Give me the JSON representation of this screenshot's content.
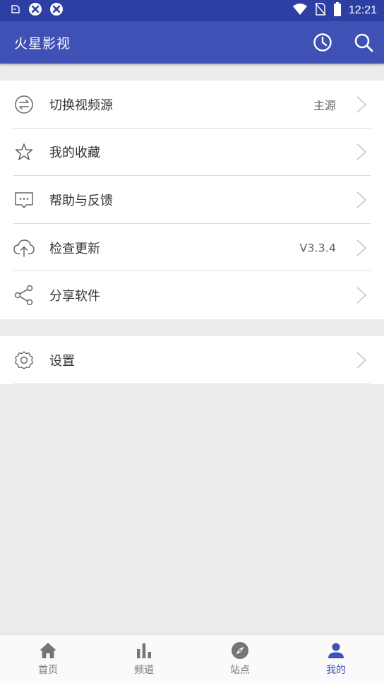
{
  "status_bar": {
    "time": "12:21",
    "icons": [
      "notification-icon",
      "app-notification-icon",
      "app-notification-icon",
      "wifi-icon",
      "no-sim-icon",
      "battery-icon"
    ]
  },
  "app_bar": {
    "title": "火星影视",
    "actions": [
      "history-icon",
      "search-icon"
    ]
  },
  "menu_group_1": [
    {
      "label": "切换视频源",
      "value": "主源",
      "icon": "switch-icon"
    },
    {
      "label": "我的收藏",
      "value": "",
      "icon": "star-icon"
    },
    {
      "label": "帮助与反馈",
      "value": "",
      "icon": "feedback-icon"
    },
    {
      "label": "检查更新",
      "value": "V3.3.4",
      "icon": "cloud-upload-icon"
    },
    {
      "label": "分享软件",
      "value": "",
      "icon": "share-icon"
    }
  ],
  "menu_group_2": [
    {
      "label": "设置",
      "value": "",
      "icon": "settings-icon"
    }
  ],
  "bottom_nav": {
    "items": [
      {
        "label": "首页",
        "icon": "home-icon"
      },
      {
        "label": "频道",
        "icon": "bar-chart-icon"
      },
      {
        "label": "站点",
        "icon": "compass-icon"
      },
      {
        "label": "我的",
        "icon": "person-icon"
      }
    ],
    "active_index": 3
  },
  "colors": {
    "status_bar": "#2d3fa3",
    "app_bar": "#3f51b5",
    "accent": "#3f51b5",
    "background": "#ececec"
  }
}
